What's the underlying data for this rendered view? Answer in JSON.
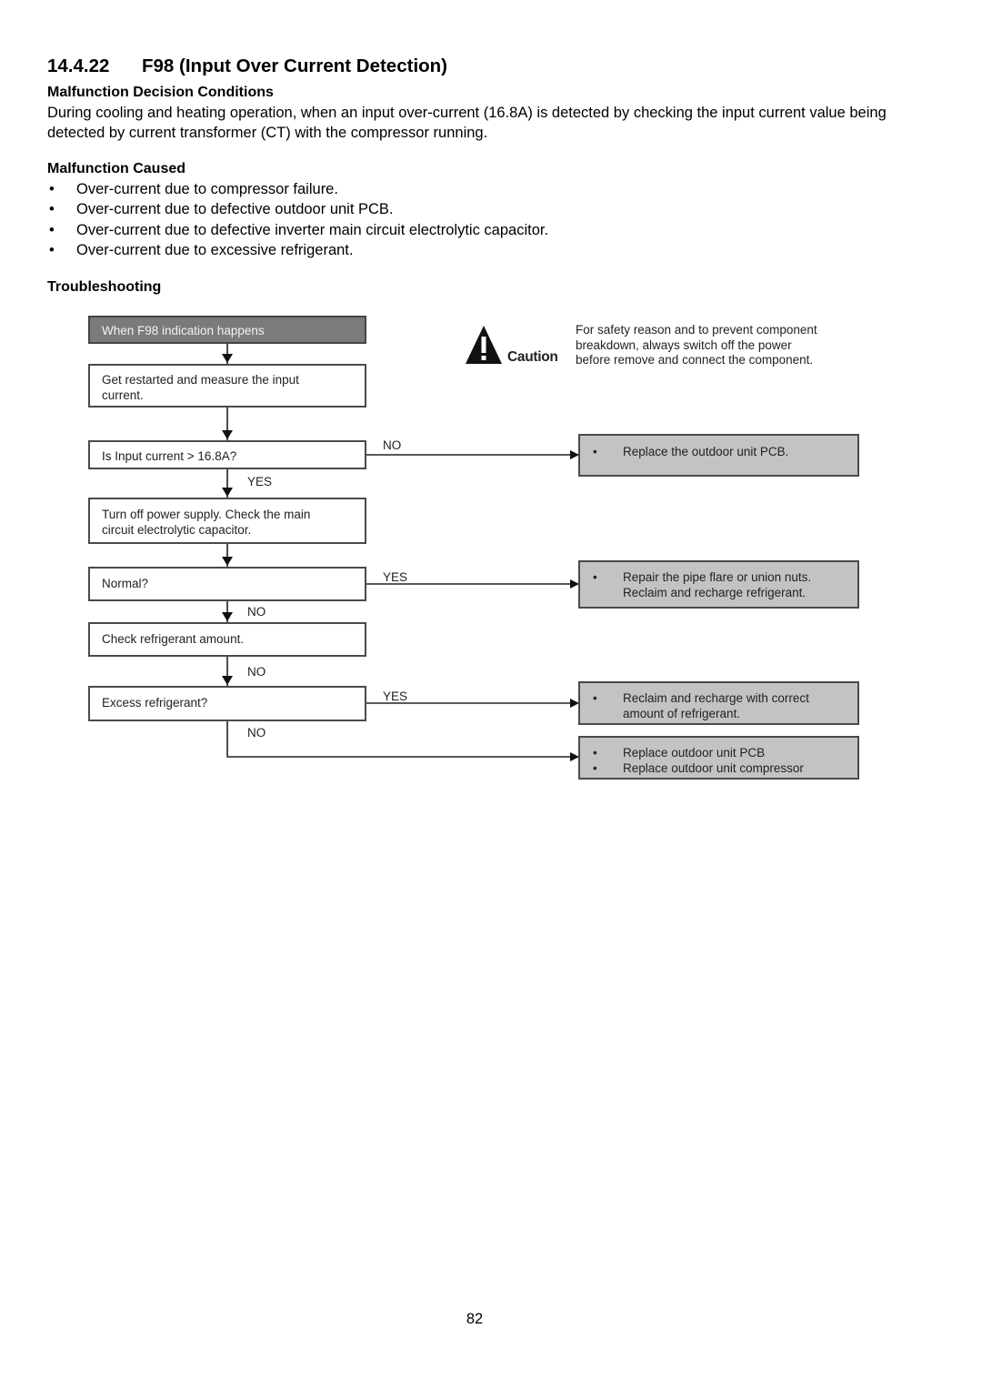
{
  "section": {
    "number": "14.4.22",
    "title": "F98 (Input Over Current Detection)"
  },
  "decision_conditions": {
    "heading": "Malfunction Decision Conditions",
    "text": "During cooling and heating operation, when an input over-current (16.8A) is detected by checking the input current value being detected by current transformer (CT) with the compressor running."
  },
  "malfunction_caused": {
    "heading": "Malfunction Caused",
    "bullet_glyph": "•",
    "items": [
      "Over-current due to compressor failure.",
      "Over-current due to defective outdoor unit PCB.",
      "Over-current due to defective inverter main circuit electrolytic capacitor.",
      "Over-current due to excessive refrigerant."
    ]
  },
  "troubleshooting": {
    "heading": "Troubleshooting",
    "caution": {
      "icon": "warning-triangle-icon",
      "word": "Caution",
      "text_lines": [
        "For safety reason and to prevent component",
        "breakdown, always switch off the power",
        "before remove and connect the component."
      ]
    },
    "steps": [
      {
        "lines": [
          "When F98 indication happens"
        ]
      },
      {
        "lines": [
          "Get restarted and measure the input",
          "current."
        ]
      },
      {
        "lines": [
          "Is Input current > 16.8A?"
        ]
      },
      {
        "lines": [
          "Turn off power supply. Check the main",
          "circuit electrolytic capacitor."
        ]
      },
      {
        "lines": [
          "Normal?"
        ]
      },
      {
        "lines": [
          "Check refrigerant amount."
        ]
      },
      {
        "lines": [
          "Excess refrigerant?"
        ]
      }
    ],
    "branch_labels": {
      "input_current_no": "NO",
      "input_current_yes": "YES",
      "normal_yes": "YES",
      "normal_no": "NO",
      "check_refrigerant_no": "NO",
      "excess_yes": "YES",
      "excess_no": "NO"
    },
    "results": [
      {
        "items": [
          [
            "Replace the outdoor unit PCB."
          ]
        ]
      },
      {
        "items": [
          [
            "Repair the pipe flare or union nuts.",
            "Reclaim and recharge refrigerant."
          ]
        ]
      },
      {
        "items": [
          [
            "Reclaim and recharge with correct",
            "amount of refrigerant."
          ]
        ]
      },
      {
        "items": [
          [
            "Replace outdoor unit PCB"
          ],
          [
            "Replace outdoor unit compressor"
          ]
        ]
      }
    ]
  },
  "page_number": "82"
}
